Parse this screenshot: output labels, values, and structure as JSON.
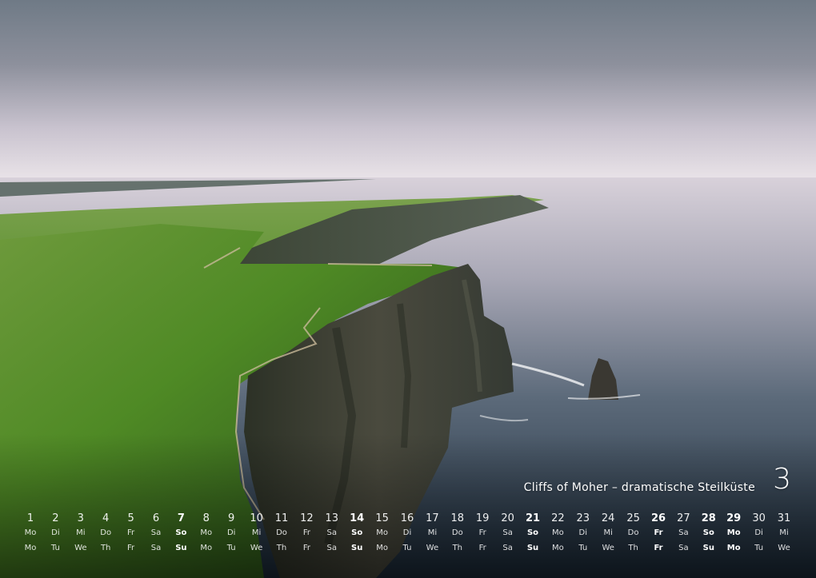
{
  "caption": "Cliffs of Moher – dramatische Steilküste",
  "month_number": "3",
  "calendar": {
    "days": [
      {
        "num": "1",
        "de": "Mo",
        "en": "Mo",
        "hl": false
      },
      {
        "num": "2",
        "de": "Di",
        "en": "Tu",
        "hl": false
      },
      {
        "num": "3",
        "de": "Mi",
        "en": "We",
        "hl": false
      },
      {
        "num": "4",
        "de": "Do",
        "en": "Th",
        "hl": false
      },
      {
        "num": "5",
        "de": "Fr",
        "en": "Fr",
        "hl": false
      },
      {
        "num": "6",
        "de": "Sa",
        "en": "Sa",
        "hl": false
      },
      {
        "num": "7",
        "de": "So",
        "en": "Su",
        "hl": true
      },
      {
        "num": "8",
        "de": "Mo",
        "en": "Mo",
        "hl": false
      },
      {
        "num": "9",
        "de": "Di",
        "en": "Tu",
        "hl": false
      },
      {
        "num": "10",
        "de": "Mi",
        "en": "We",
        "hl": false
      },
      {
        "num": "11",
        "de": "Do",
        "en": "Th",
        "hl": false
      },
      {
        "num": "12",
        "de": "Fr",
        "en": "Fr",
        "hl": false
      },
      {
        "num": "13",
        "de": "Sa",
        "en": "Sa",
        "hl": false
      },
      {
        "num": "14",
        "de": "So",
        "en": "Su",
        "hl": true
      },
      {
        "num": "15",
        "de": "Mo",
        "en": "Mo",
        "hl": false
      },
      {
        "num": "16",
        "de": "Di",
        "en": "Tu",
        "hl": false
      },
      {
        "num": "17",
        "de": "Mi",
        "en": "We",
        "hl": false
      },
      {
        "num": "18",
        "de": "Do",
        "en": "Th",
        "hl": false
      },
      {
        "num": "19",
        "de": "Fr",
        "en": "Fr",
        "hl": false
      },
      {
        "num": "20",
        "de": "Sa",
        "en": "Sa",
        "hl": false
      },
      {
        "num": "21",
        "de": "So",
        "en": "Su",
        "hl": true
      },
      {
        "num": "22",
        "de": "Mo",
        "en": "Mo",
        "hl": false
      },
      {
        "num": "23",
        "de": "Di",
        "en": "Tu",
        "hl": false
      },
      {
        "num": "24",
        "de": "Mi",
        "en": "We",
        "hl": false
      },
      {
        "num": "25",
        "de": "Do",
        "en": "Th",
        "hl": false
      },
      {
        "num": "26",
        "de": "Fr",
        "en": "Fr",
        "hl": true
      },
      {
        "num": "27",
        "de": "Sa",
        "en": "Sa",
        "hl": false
      },
      {
        "num": "28",
        "de": "So",
        "en": "Su",
        "hl": true
      },
      {
        "num": "29",
        "de": "Mo",
        "en": "Mo",
        "hl": true
      },
      {
        "num": "30",
        "de": "Di",
        "en": "Tu",
        "hl": false
      },
      {
        "num": "31",
        "de": "Mi",
        "en": "We",
        "hl": false
      }
    ]
  }
}
